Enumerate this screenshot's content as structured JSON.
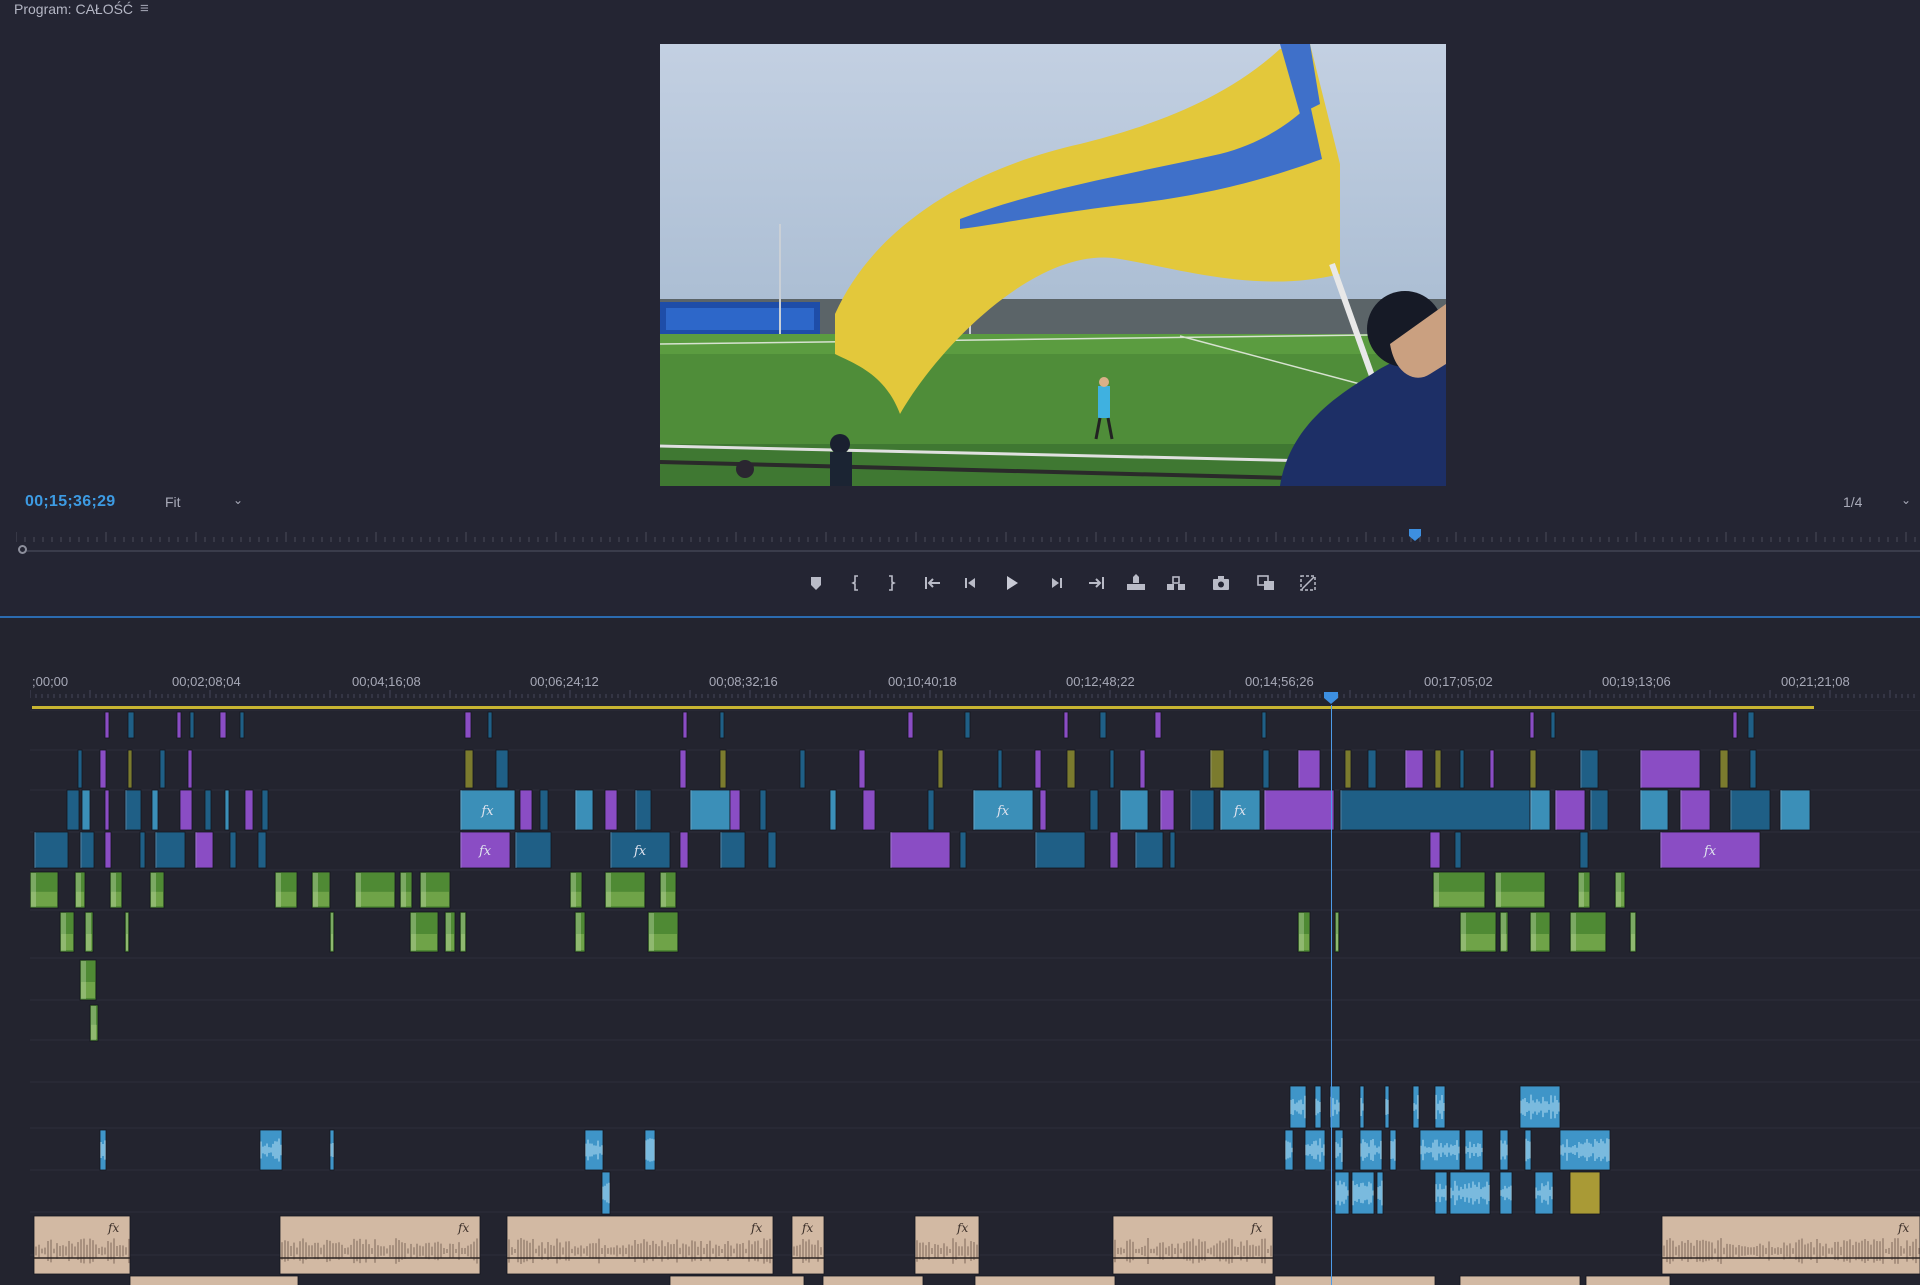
{
  "program": {
    "title": "Program: CAŁOŚĆ",
    "menu_icon": "hamburger-menu-icon"
  },
  "monitor": {
    "timecode": "00;15;36;29",
    "zoom": "Fit",
    "resolution": "1/4",
    "playhead_fraction": 0.735
  },
  "transport": {
    "buttons": [
      {
        "name": "add-marker-button",
        "icon": "marker-icon"
      },
      {
        "name": "mark-in-button",
        "icon": "mark-in-icon"
      },
      {
        "name": "mark-out-button",
        "icon": "mark-out-icon"
      },
      {
        "name": "go-to-in-button",
        "icon": "go-to-in-icon"
      },
      {
        "name": "step-back-button",
        "icon": "step-back-icon"
      },
      {
        "name": "play-button",
        "icon": "play-icon"
      },
      {
        "name": "step-forward-button",
        "icon": "step-forward-icon"
      },
      {
        "name": "go-to-out-button",
        "icon": "go-to-out-icon"
      },
      {
        "name": "lift-button",
        "icon": "lift-icon"
      },
      {
        "name": "extract-button",
        "icon": "extract-icon"
      },
      {
        "name": "export-frame-button",
        "icon": "camera-icon"
      },
      {
        "name": "comparison-view-button",
        "icon": "comparison-icon"
      },
      {
        "name": "toggle-proxies-button",
        "icon": "proxy-icon"
      }
    ]
  },
  "timeline": {
    "ruler": [
      ";00;00",
      "00;02;08;04",
      "00;04;16;08",
      "00;06;24;12",
      "00;08;32;16",
      "00;10;40;18",
      "00;12;48;22",
      "00;14;56;26",
      "00;17;05;02",
      "00;19;13;06",
      "00;21;21;08"
    ],
    "playhead_fraction": 0.73,
    "colors": {
      "video_blue": "#1f5f86",
      "video_violet": "#8a4dc4",
      "video_cyan": "#3b8fb8",
      "video_olive": "#7b7b2e",
      "audio_green": "#4f8a34",
      "audio_lightblue": "#3f95c8",
      "audio_tan": "#d2b9a3",
      "audio_yellow": "#a99a36",
      "workbar": "#c8b531",
      "playhead": "#4d9be8",
      "divider": "#2b6bb0"
    }
  }
}
